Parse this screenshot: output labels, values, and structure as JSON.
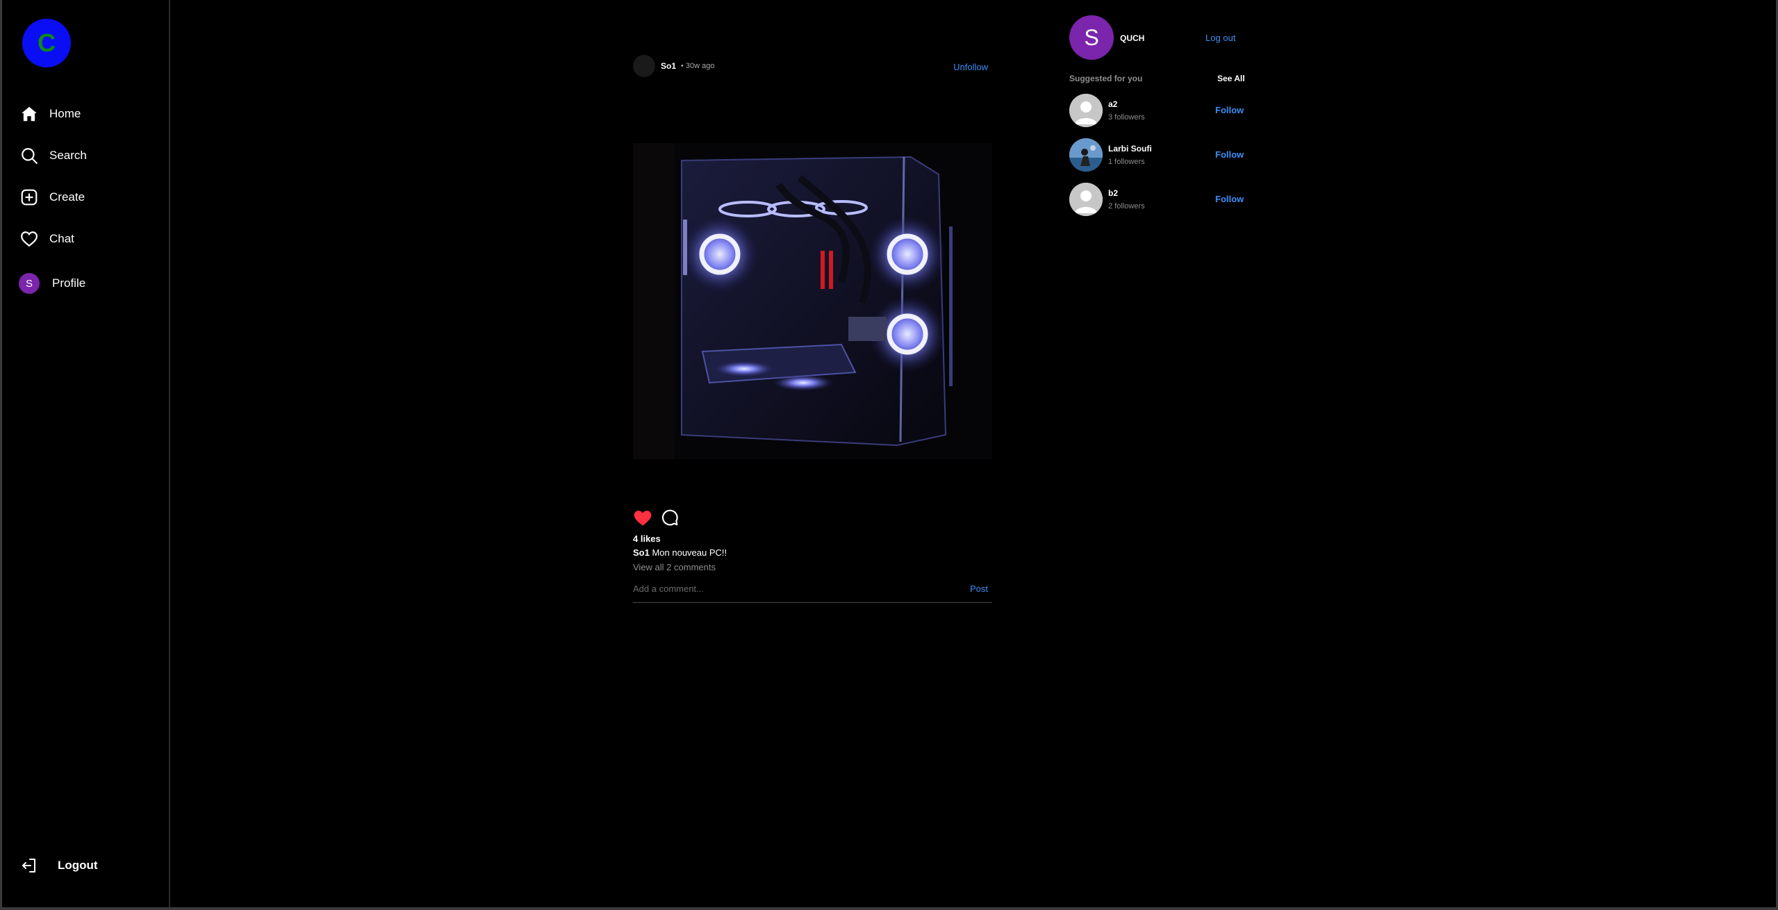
{
  "sidebar": {
    "logo_letter": "C",
    "items": [
      {
        "label": "Home",
        "icon": "home-icon"
      },
      {
        "label": "Search",
        "icon": "search-icon"
      },
      {
        "label": "Create",
        "icon": "plus-square-icon"
      },
      {
        "label": "Chat",
        "icon": "heart-icon"
      },
      {
        "label": "Profile",
        "icon": "avatar",
        "avatar_letter": "S"
      }
    ],
    "logout_label": "Logout"
  },
  "post": {
    "username": "So1",
    "time": "• 30w ago",
    "unfollow_label": "Unfollow",
    "image_alt": "PC build photo",
    "likes": "4 likes",
    "caption_user": "So1",
    "caption_text": "Mon nouveau PC!!",
    "view_comments": "View all 2 comments",
    "comment_placeholder": "Add a comment...",
    "post_label": "Post",
    "liked": true
  },
  "current_user": {
    "avatar_letter": "S",
    "name": "QUCH",
    "logout_label": "Log out"
  },
  "suggestions": {
    "title": "Suggested for you",
    "see_all": "See All",
    "users": [
      {
        "name": "a2",
        "followers": "3 followers",
        "action": "Follow",
        "avatar": "default-avatar"
      },
      {
        "name": "Larbi Soufi",
        "followers": "1 followers",
        "action": "Follow",
        "avatar": "photo-avatar"
      },
      {
        "name": "b2",
        "followers": "2 followers",
        "action": "Follow",
        "avatar": "default-avatar"
      }
    ]
  },
  "colors": {
    "background": "#000000",
    "accent_link": "#3d8ef5",
    "logo_bg": "#0a0ef5",
    "logo_letter": "#0c8a18",
    "avatar_purple": "#7b24ac",
    "like_red": "#ff3040"
  }
}
